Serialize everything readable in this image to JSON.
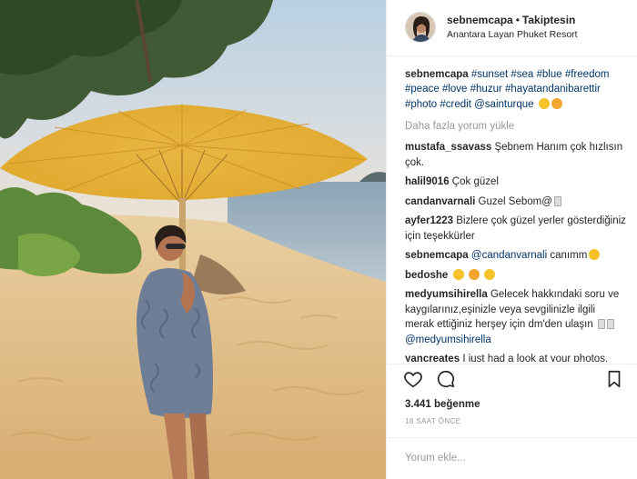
{
  "header": {
    "username": "sebnemcapa",
    "dot": "•",
    "follow_label": "Takiptesin",
    "location": "Anantara Layan Phuket Resort"
  },
  "caption": {
    "username": "sebnemcapa",
    "hashtags": [
      "#sunset",
      "#sea",
      "#blue",
      "#freedom",
      "#peace",
      "#love",
      "#huzur",
      "#hayatandanibarettir",
      "#photo",
      "#credit"
    ],
    "mention": "@sainturque"
  },
  "load_more": "Daha fazla yorum yükle",
  "comments": [
    {
      "user": "mustafa_ssavass",
      "text": "Şebnem Hanım çok hızlısın çok."
    },
    {
      "user": "halil9016",
      "text": "Çok güzel"
    },
    {
      "user": "candanvarnali",
      "text": "Guzel Sebom@"
    },
    {
      "user": "ayfer1223",
      "text": "Bizlere çok güzel yerler gösterdiğiniz için teşekkürler"
    },
    {
      "user": "sebnemcapa",
      "mention": "@candanvarnali",
      "text": "canımm"
    },
    {
      "user": "bedoshe",
      "text": ""
    },
    {
      "user": "medyumsihirella",
      "text": "Gelecek hakkındaki soru ve kaygılarınız,eşinizle veya sevgilinizle ilgili merak ettiğiniz herşey için dm'den ulaşın",
      "mention": "@medyumsihirella"
    },
    {
      "user": "yancreates",
      "text": "I just had a look at your photos."
    }
  ],
  "likes": "3.441 beğenme",
  "time": "18 SAAT ÖNCE",
  "add_comment": {
    "placeholder": "Yorum ekle..."
  },
  "icons": {
    "like": "heart-icon",
    "comment": "comment-bubble-icon",
    "save": "bookmark-icon"
  }
}
